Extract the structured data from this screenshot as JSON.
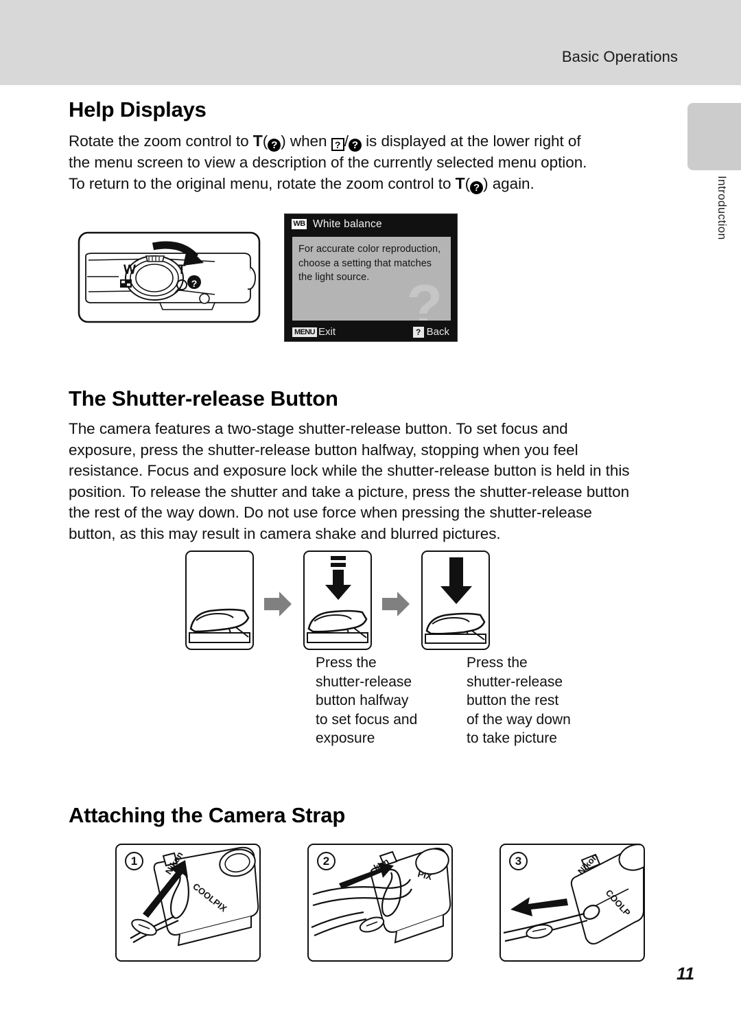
{
  "header": {
    "section_title": "Basic Operations"
  },
  "side_tab": {
    "label": "Introduction"
  },
  "sections": {
    "help_displays": {
      "heading": "Help Displays",
      "paragraph_lines": [
        "Rotate the zoom control to  T ( ? ) when  [?] / ( ? )  is displayed at the lower right of",
        "the menu screen to view a description of the currently selected menu option.",
        "To return to the original menu, rotate the zoom control to  T ( ? )  again."
      ],
      "line1_a": "Rotate the zoom control to ",
      "line1_t": "T",
      "line1_b": ") when ",
      "line1_c": "/",
      "line1_d": " is displayed at the lower right of",
      "line2": "the menu screen to view a description of the currently selected menu option.",
      "line3_a": "To return to the original menu, rotate the zoom control to ",
      "line3_t": "T",
      "line3_b": ") again.",
      "tele_mark": "T",
      "help_glyph": "?",
      "paren_open": "(",
      "paren_close": ")"
    },
    "shutter_release": {
      "heading": "The Shutter-release Button",
      "paragraph_lines": [
        "The camera features a two-stage shutter-release button. To set focus and",
        "exposure, press the shutter-release button halfway, stopping when you feel",
        "resistance. Focus and exposure lock while the shutter-release button is held in this",
        "position. To release the shutter and take a picture, press the shutter-release button",
        "the rest of the way down. Do not use force when pressing the shutter-release",
        "button, as this may result in camera shake and blurred pictures."
      ],
      "captions": [
        {
          "lines": [
            "Press the",
            "shutter-release",
            "button halfway",
            "to set focus and",
            "exposure"
          ]
        },
        {
          "lines": [
            "Press the",
            "shutter-release",
            "button the rest",
            "of the way down",
            "to take picture"
          ]
        }
      ]
    },
    "camera_strap": {
      "heading": "Attaching the Camera Strap",
      "steps": [
        {
          "number": "1",
          "brand": "Nikon",
          "model": "COOLPIX"
        },
        {
          "number": "2",
          "brand": "kon",
          "model": "PIX"
        },
        {
          "number": "3",
          "brand": "Nikon",
          "model": "COOLP"
        }
      ]
    }
  },
  "camera_diagram": {
    "wide_label": "W",
    "tele_label": "T",
    "thumbnail_icon": "thumbnail-grid-icon",
    "magnifier_icon": "magnifier-icon",
    "help_icon": "help-question-icon"
  },
  "lcd_screen": {
    "icon_label": "WB",
    "title": "White balance",
    "body_lines": [
      "For accurate color reproduction,",
      "choose a setting that matches",
      "the light source."
    ],
    "watermark": "?",
    "footer_menu_badge": "MENU",
    "footer_menu_label": "Exit",
    "footer_back_badge": "?",
    "footer_back_label": "Back"
  },
  "footer": {
    "page_number": "11"
  },
  "colors": {
    "header_band": "#d8d8d8",
    "side_tab": "#cccccc",
    "lcd_bezel": "#111111",
    "lcd_panel": "#b4b4b4",
    "arrow_gray": "#808080",
    "text": "#111111"
  }
}
